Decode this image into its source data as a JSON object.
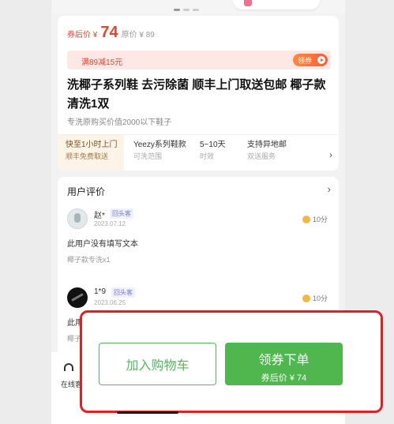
{
  "product": {
    "price_label": "券后价 ¥",
    "price_value": "74",
    "original_price": "原价 ¥ 89",
    "coupon_text": "满89减15元",
    "coupon_button": "领券",
    "title": "洗椰子系列鞋 去污除菌 顺丰上门取送包邮 椰子款清洗1双",
    "subtitle": "专洗原购买价值2000以下鞋子"
  },
  "features": [
    {
      "title": "快至1小时上门",
      "sub": "顺丰免费取送"
    },
    {
      "title": "Yeezy系列鞋款",
      "sub": "可洗范围"
    },
    {
      "title": "5~10天",
      "sub": "时效"
    },
    {
      "title": "支持异地邮",
      "sub": "双送服务"
    }
  ],
  "reviews": {
    "title": "用户评价",
    "items": [
      {
        "name": "赵*",
        "tag": "回头客",
        "date": "2023.07.12",
        "score": "10分",
        "text": "此用户没有填写文本",
        "sub": "椰子款专洗x1"
      },
      {
        "name": "1*9",
        "tag": "回头客",
        "date": "2023.06.25",
        "score": "10分",
        "text": "此用",
        "sub": "椰子"
      }
    ]
  },
  "bottom": {
    "service_label": "在线客",
    "cart_button": "加入购物车",
    "order_button": "领券下单",
    "order_sub": "券后价 ¥ 74"
  },
  "colors": {
    "price_red": "#e8452c",
    "primary_green": "#50b74f",
    "highlight_red": "#e32020"
  }
}
